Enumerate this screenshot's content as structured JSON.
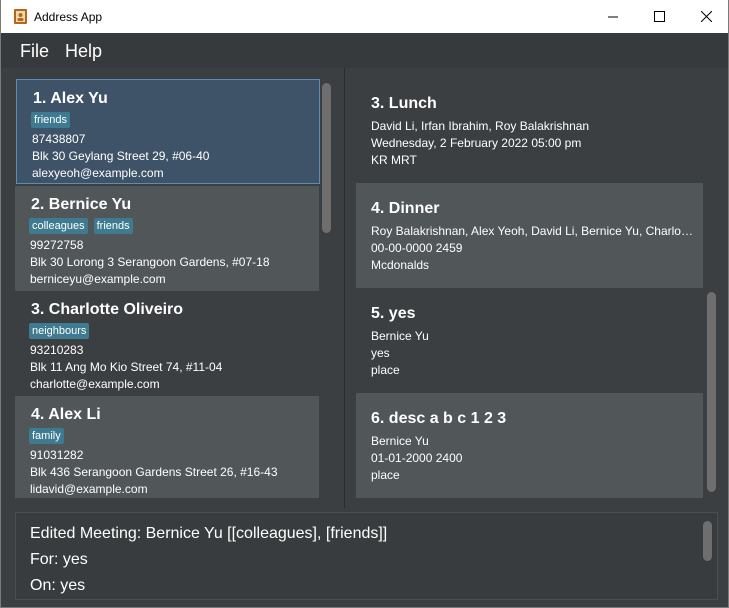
{
  "window": {
    "title": "Address App",
    "minimize": "—",
    "maximize": "☐",
    "close": "✕"
  },
  "menu": {
    "file": "File",
    "help": "Help"
  },
  "persons": [
    {
      "title": "1.  Alex Yu",
      "tags": [
        "friends"
      ],
      "phone": "87438807",
      "address": "Blk 30 Geylang Street 29, #06-40",
      "email": "alexyeoh@example.com"
    },
    {
      "title": "2.  Bernice Yu",
      "tags": [
        "colleagues",
        "friends"
      ],
      "phone": "99272758",
      "address": "Blk 30 Lorong 3 Serangoon Gardens, #07-18",
      "email": "berniceyu@example.com"
    },
    {
      "title": "3.  Charlotte Oliveiro",
      "tags": [
        "neighbours"
      ],
      "phone": "93210283",
      "address": "Blk 11 Ang Mo Kio Street 74, #11-04",
      "email": "charlotte@example.com"
    },
    {
      "title": "4.  Alex Li",
      "tags": [
        "family"
      ],
      "phone": "91031282",
      "address": "Blk 436 Serangoon Gardens Street 26, #16-43",
      "email": "lidavid@example.com"
    }
  ],
  "meetings": [
    {
      "title": "3.  Lunch",
      "people": "David Li, Irfan Ibrahim, Roy Balakrishnan",
      "time": "Wednesday, 2 February 2022 05:00 pm",
      "place": "KR MRT"
    },
    {
      "title": "4.  Dinner",
      "people": "Roy Balakrishnan, Alex Yeoh, David Li, Bernice Yu, Charlotte Oliveiro",
      "time": "00-00-0000 2459",
      "place": "Mcdonalds"
    },
    {
      "title": "5.  yes",
      "people": "Bernice Yu",
      "time": "yes",
      "place": "place"
    },
    {
      "title": "6.  desc a b c 1 2 3",
      "people": "Bernice Yu",
      "time": "01-01-2000 2400",
      "place": "place"
    }
  ],
  "result": {
    "line1": "Edited Meeting: Bernice Yu [[colleagues], [friends]]",
    "line2": "For: yes",
    "line3": "On: yes"
  },
  "icons": {
    "app": "address-book-icon"
  },
  "colors": {
    "selected_card": "#3e5368",
    "tag": "#3e7b91",
    "background": "#3c3f41"
  }
}
